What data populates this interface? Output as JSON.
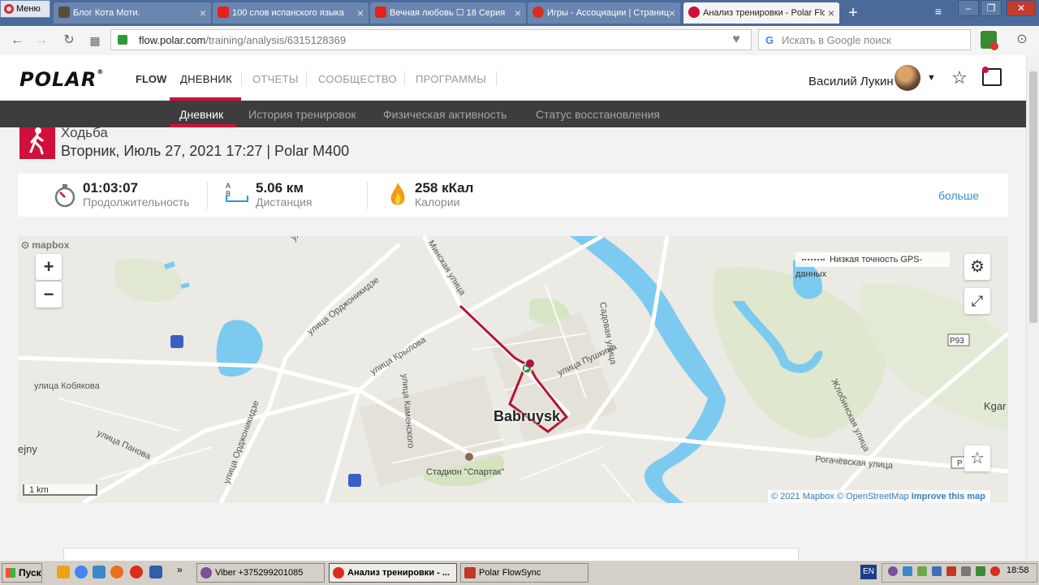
{
  "browser": {
    "menu_label": "Меню",
    "tabs": [
      {
        "label": "Блог Кота Моти.",
        "favicon_color": "#5b4b3b"
      },
      {
        "label": "100 слов испанского языка",
        "favicon_color": "#e62117"
      },
      {
        "label": "Вечная любовь ☐ 18 Серия",
        "favicon_color": "#e62117"
      },
      {
        "label": "Игры - Ассоциации | Страница",
        "favicon_color": "#d92d20"
      },
      {
        "label": "Анализ тренировки - Polar Flow",
        "favicon_color": "#d0103a"
      }
    ],
    "active_tab_index": 4,
    "new_tab_label": "+",
    "url_domain": "flow.polar.com",
    "url_path": "/training/analysis/6315128369",
    "search_placeholder": "Искать в Google поиск",
    "search_engine_letter": "G"
  },
  "site": {
    "logo": "POLAR",
    "logo_reg": "®",
    "product": "FLOW",
    "nav": [
      "ДНЕВНИК",
      "ОТЧЕТЫ",
      "СООБЩЕСТВО",
      "ПРОГРАММЫ"
    ],
    "active_nav_index": 0,
    "user_name": "Василий Лукин",
    "subnav": [
      "Дневник",
      "История тренировок",
      "Физическая активность",
      "Статус восстановления"
    ],
    "active_subnav_index": 0,
    "accent_color": "#d0103a"
  },
  "training": {
    "sport": "Ходьба",
    "datetime": "Вторник, Июль 27, 2021 17:27 | Polar M400",
    "duration_value": "01:03:07",
    "duration_label": "Продолжительность",
    "distance_value": "5.06 км",
    "distance_label": "Дистанция",
    "distance_icon_letters": "A B",
    "calories_value": "258 кКал",
    "calories_label": "Калории",
    "more_label": "больше"
  },
  "map": {
    "brand": "mapbox",
    "zoom_in": "+",
    "zoom_out": "−",
    "legend_text": "Низкая точность GPS-данных",
    "city": "Babruysk",
    "scale": "1 km",
    "attribution_copy": "© 2021 Mapbox",
    "attribution_osm": "© OpenStreetMap",
    "attribution_improve": "Improve this map",
    "streets": [
      "улица Орджоникидзе",
      "Минская улица",
      "улица Крылова",
      "улица Кобякова",
      "улица Каменского",
      "улица Пушкина",
      "Садовая улица",
      "улица Панова",
      "улица Орджоникидзе",
      "Стадион \"Спартак\"",
      "Жлобинская улица",
      "Рогачёвская улица",
      "улица"
    ],
    "road_badge": "P93",
    "edge_labels": [
      "Kgar",
      "ejny",
      "Р"
    ],
    "route_color": "#b0163a"
  },
  "taskbar": {
    "start": "Пуск",
    "windows": [
      {
        "label": "Viber +375299201085",
        "icon_color": "#7b519d"
      },
      {
        "label": "Анализ тренировки - ...",
        "icon_color": "#d92d20"
      },
      {
        "label": "Polar FlowSync",
        "icon_color": "#c0392b"
      }
    ],
    "active_window_index": 1,
    "lang": "EN",
    "clock": "18:58"
  }
}
